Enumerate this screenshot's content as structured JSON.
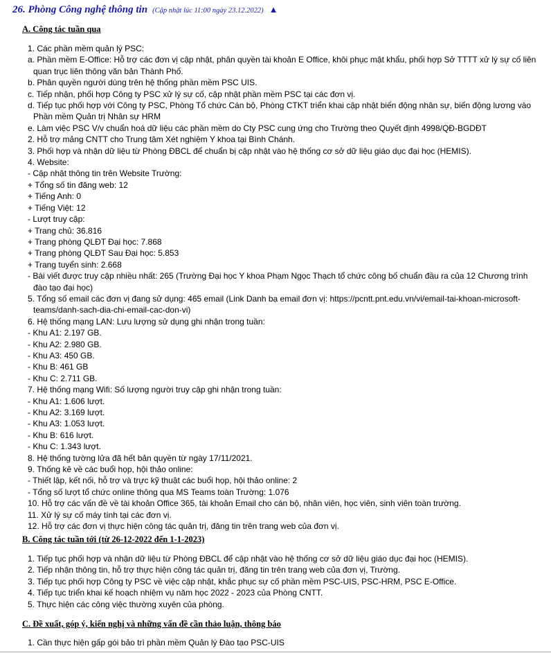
{
  "header": {
    "title": "26. Phòng Công nghệ thông tin",
    "updated": "(Cập nhật lúc 11:00 ngày 23.12.2022)",
    "up_icon": "▲"
  },
  "section_a": {
    "heading": "A. Công tác tuần qua",
    "lines": [
      "1. Các phần mềm quản lý PSC:",
      "a. Phần mềm E-Office: Hỗ trợ các đơn vị cập nhật, phân quyền tài khoản E Office, khôi phục mật khẩu, phối hợp Sở TTTT xử lý sự cố liên quan trục liên thông văn bản Thành Phố.",
      "b. Phân quyền người dùng trên hệ thống phần mềm PSC UIS.",
      "c. Tiếp nhận, phối hợp Công ty PSC xử lý sự cố, cập nhật phần mềm PSC tại các đơn vị.",
      "d. Tiếp tục phối hợp với Công ty PSC, Phòng Tổ chức Cán bộ, Phòng CTKT triển khai cập nhật biến động nhân sự, biến động lương vào Phần mềm Quản trị Nhân sự HRM",
      "e. Làm việc PSC V/v chuẩn hoá dữ liệu các phần mềm do Cty PSC cung ứng cho Trường theo Quyết định 4998/QĐ-BGDĐT",
      "2. Hỗ trợ mảng CNTT cho Trung tâm Xét nghiệm Y khoa tại Bình Chánh.",
      "3. Phối hợp và nhận dữ liệu từ Phòng ĐBCL để chuẩn bị cập nhật vào hệ thống cơ sở dữ liệu giáo dục đại học (HEMIS).",
      "4. Website:",
      "- Cập nhật thông tin trên Website Trường:",
      "+ Tổng số tin đăng web: 12",
      "+ Tiếng Anh: 0",
      "+ Tiếng Việt: 12",
      "- Lượt truy cập:",
      "+ Trang chủ: 36.816",
      "+ Trang phòng QLĐT Đại học: 7.868",
      "+ Trang phòng QLĐT Sau Đại học: 5.853",
      "+ Trang tuyển sinh: 2.668",
      "- Bài viết được truy cập nhiều nhất: 265 (Trường Đại học Y khoa Phạm Ngọc Thạch tổ chức công bố chuẩn đầu ra của 12 Chương trình đào tạo đại học)",
      "5. Tổng số email các đơn vị đang sử dụng: 465 email (Link Danh bạ email đơn vị: https://pcntt.pnt.edu.vn/vi/email-tai-khoan-microsoft-teams/danh-sach-dia-chi-email-cac-don-vi)",
      "6. Hệ thống mạng LAN: Lưu lượng sử dụng ghi nhận trong tuần:",
      "- Khu A1: 2.197 GB.",
      "- Khu A2: 2.980 GB.",
      "- Khu A3: 450 GB.",
      "- Khu B: 461 GB",
      "- Khu C: 2.711 GB.",
      "7. Hệ thống mạng Wifi: Số lượng người truy cập ghi nhận trong tuần:",
      "- Khu A1: 1.606 lượt.",
      "- Khu A2: 3.169 lượt.",
      "- Khu A3: 1.053 lượt.",
      "- Khu B: 616 lượt.",
      "- Khu C: 1.343 lượt.",
      "8. Hệ thống tường lửa đã hết bản quyền từ ngày 17/11/2021.",
      "9. Thống kê về các buổi họp, hội thảo online:",
      "- Thiết lập, kết nối, hỗ trợ và trực kỹ thuật các buổi họp, hội thảo online: 2",
      "- Tổng số lượt tổ chức online thông qua MS Teams toàn Trường: 1.076",
      "10. Hỗ trợ các vấn đề về tài khoản Office 365, tài khoản Email cho cán bộ, nhân viên, học viên, sinh viên toàn trường.",
      "11. Xử lý sự cố máy tính tại các đơn vị.",
      "12. Hỗ trợ các đơn vị thực hiện công tác quản trị, đăng tin trên trang web của đơn vị."
    ]
  },
  "section_b": {
    "heading": "B. Công tác tuần tới (từ 26-12-2022 đến 1-1-2023)",
    "lines": [
      "1. Tiếp tục phối hợp và nhận dữ liệu từ Phòng ĐBCL để cập nhật vào hệ thống cơ sở dữ liệu giáo dục đại học (HEMIS).",
      "2. Tiếp nhận thông tin, hỗ trợ thực hiện công tác quản trị, đăng tin trên trang web của đơn vị, Trường.",
      "3. Tiếp tục phối hợp Công ty PSC về việc cập nhật, khắc phục sự cố phần mềm PSC-UIS, PSC-HRM, PSC E-Office.",
      "4. Tiếp tục triển khai kế hoạch nhiệm vụ năm học 2022 - 2023 của Phòng CNTT.",
      "5. Thực hiện các công việc thường xuyên của phòng."
    ]
  },
  "section_c": {
    "heading": "C. Đề xuất, góp ý, kiến nghị và những vấn đề cần thảo luận, thông báo",
    "lines": [
      "1. Cần thực hiện gấp gói bảo trì phần mềm Quản lý Đào tạo PSC-UIS"
    ]
  }
}
